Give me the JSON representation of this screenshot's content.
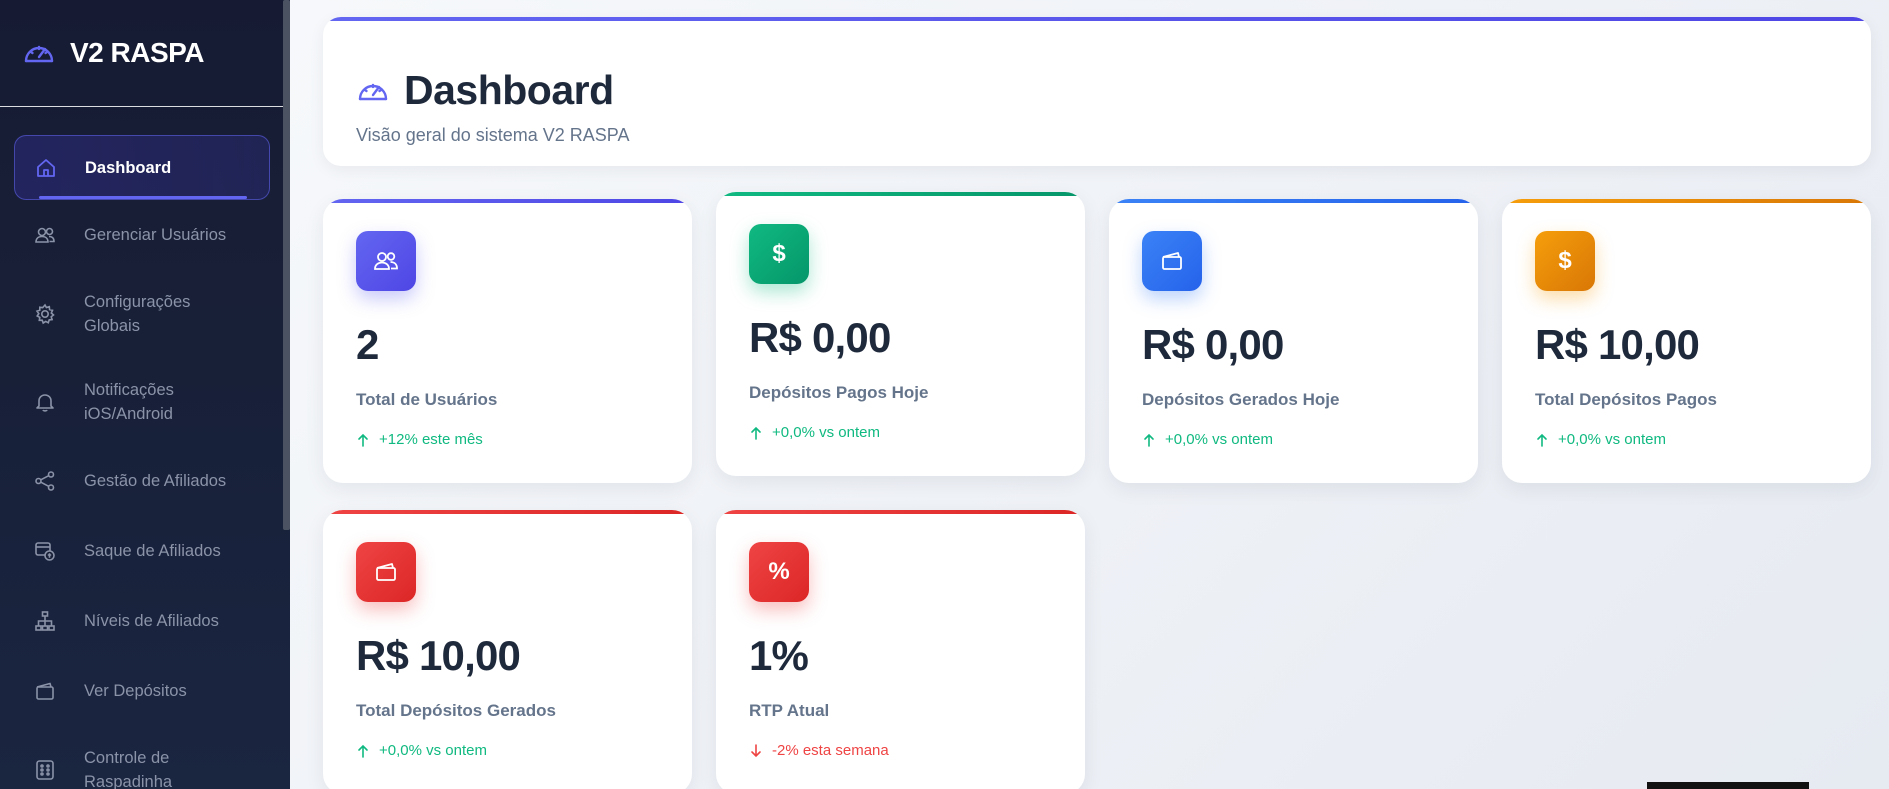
{
  "sidebar": {
    "brand": "V2 RASPA",
    "items": [
      {
        "label": "Dashboard",
        "icon": "home-icon",
        "active": true
      },
      {
        "label": "Gerenciar Usuários",
        "icon": "users-icon"
      },
      {
        "label": "Configurações Globais",
        "icon": "gear-icon"
      },
      {
        "label": "Notificações iOS/Android",
        "icon": "bell-icon"
      },
      {
        "label": "Gestão de Afiliados",
        "icon": "share-icon"
      },
      {
        "label": "Saque de Afiliados",
        "icon": "withdraw-icon"
      },
      {
        "label": "Níveis de Afiliados",
        "icon": "hierarchy-icon"
      },
      {
        "label": "Ver Depósitos",
        "icon": "wallet-icon"
      },
      {
        "label": "Controle de Raspadinha",
        "icon": "ticket-icon"
      }
    ]
  },
  "header": {
    "title": "Dashboard",
    "subtitle": "Visão geral do sistema V2 RASPA"
  },
  "stats": [
    {
      "value": "2",
      "label": "Total de Usuários",
      "trend": "+12% este mês",
      "direction": "up",
      "icon": "users-icon",
      "color": "#6366f1"
    },
    {
      "value": "R$ 0,00",
      "label": "Depósitos Pagos Hoje",
      "trend": "+0,0% vs ontem",
      "direction": "up",
      "icon": "dollar-icon",
      "color": "#10b981"
    },
    {
      "value": "R$ 0,00",
      "label": "Depósitos Gerados Hoje",
      "trend": "+0,0% vs ontem",
      "direction": "up",
      "icon": "wallet-icon",
      "color": "#3b82f6"
    },
    {
      "value": "R$ 10,00",
      "label": "Total Depósitos Pagos",
      "trend": "+0,0% vs ontem",
      "direction": "up",
      "icon": "dollar-icon",
      "color": "#f59e0b"
    },
    {
      "value": "R$ 10,00",
      "label": "Total Depósitos Gerados",
      "trend": "+0,0% vs ontem",
      "direction": "up",
      "icon": "wallet-icon",
      "color": "#ef4444"
    },
    {
      "value": "1%",
      "label": "RTP Atual",
      "trend": "-2% esta semana",
      "direction": "down",
      "icon": "percent-icon",
      "color": "#ef4444"
    }
  ],
  "colors": {
    "accent": "#6366f1",
    "positive": "#10b981",
    "negative": "#ef4444",
    "sidebar_bg": "#161b33"
  }
}
